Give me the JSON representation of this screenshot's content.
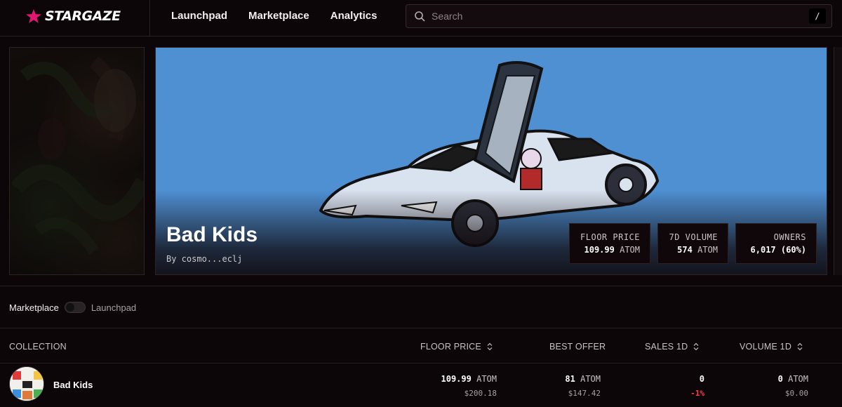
{
  "brand": {
    "name": "STARGAZE",
    "accent": "#e2186f"
  },
  "nav": {
    "launchpad": "Launchpad",
    "marketplace": "Marketplace",
    "analytics": "Analytics"
  },
  "search": {
    "placeholder": "Search",
    "shortcut": "/"
  },
  "hero": {
    "title": "Bad Kids",
    "creator": "By cosmo...eclj",
    "stats": [
      {
        "label": "FLOOR PRICE",
        "value": "109.99",
        "unit": "ATOM"
      },
      {
        "label": "7D VOLUME",
        "value": "574",
        "unit": "ATOM"
      },
      {
        "label": "OWNERS",
        "value": "6,017",
        "unit": "(60%)"
      }
    ]
  },
  "toggle": {
    "left_label": "Marketplace",
    "right_label": "Launchpad"
  },
  "table": {
    "headers": {
      "collection": "COLLECTION",
      "floor": "FLOOR PRICE",
      "offer": "BEST OFFER",
      "sales": "SALES 1D",
      "volume": "VOLUME 1D"
    },
    "rows": [
      {
        "name": "Bad Kids",
        "floor": "109.99",
        "floor_unit": "ATOM",
        "floor_usd": "$200.18",
        "offer": "81",
        "offer_unit": "ATOM",
        "offer_usd": "$147.42",
        "sales": "0",
        "sales_change": "-1%",
        "volume": "0",
        "volume_unit": "ATOM",
        "volume_usd": "$0.00"
      }
    ]
  }
}
